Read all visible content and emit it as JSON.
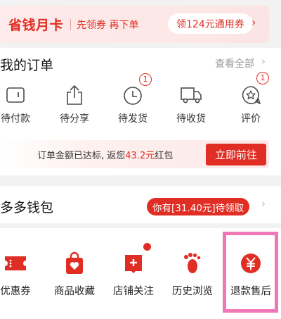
{
  "savings_card": {
    "title": "省钱月卡",
    "subtitle": "先领券 再下单",
    "coupon_pill": "领124元通用券",
    "arrow": "›"
  },
  "orders": {
    "title": "我的订单",
    "view_all": "查看全部",
    "items": [
      {
        "label": "待付款",
        "icon": "wallet-icon",
        "badge": ""
      },
      {
        "label": "待分享",
        "icon": "share-icon",
        "badge": ""
      },
      {
        "label": "待发货",
        "icon": "clock-icon",
        "badge": "1"
      },
      {
        "label": "待收货",
        "icon": "truck-icon",
        "badge": ""
      },
      {
        "label": "评价",
        "icon": "star-chat-icon",
        "badge": "1"
      }
    ],
    "promo": {
      "text_before": "订单金额已达标, 返您",
      "amount": "43.2元",
      "text_after": "红包",
      "button": "立即前往"
    }
  },
  "wallet": {
    "title": "多多钱包",
    "pill": "你有[31.40元]待领取"
  },
  "tools": {
    "items": [
      {
        "label": "优惠券",
        "icon": "ticket-icon"
      },
      {
        "label": "商品收藏",
        "icon": "bag-heart-icon"
      },
      {
        "label": "店铺关注",
        "icon": "store-plus-icon"
      },
      {
        "label": "历史浏览",
        "icon": "footprints-icon"
      },
      {
        "label": "退款售后",
        "icon": "yen-refund-icon"
      }
    ]
  },
  "colors": {
    "accent": "#e02e24",
    "highlight": "#f178b6",
    "background": "#f2f2f2"
  }
}
